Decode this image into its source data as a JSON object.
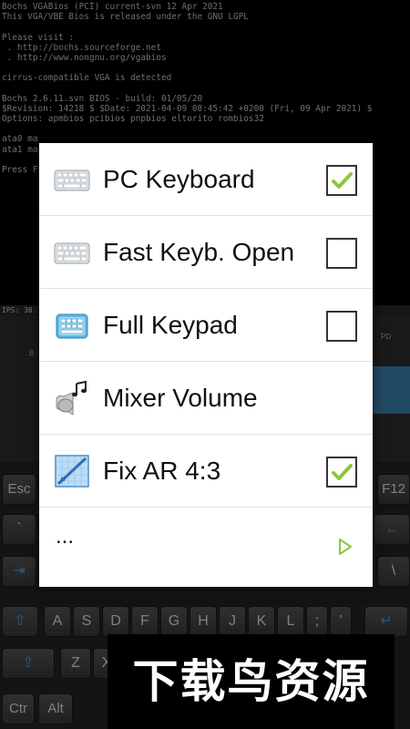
{
  "terminal": {
    "lines": [
      "Bochs VGABios (PCI) current-svn 12 Apr 2021",
      "This VGA/VBE Bios is released under the GNU LGPL",
      "",
      "Please visit :",
      " . http://bochs.sourceforge.net",
      " . http://www.nongnu.org/vgabios",
      "",
      "cirrus-compatible VGA is detected",
      "",
      "Bochs 2.6.11.svn BIOS - build: 01/05/20",
      "$Revision: 14218 $ $Date: 2021-04-09 08:45:42 +0200 (Fri, 09 Apr 2021) $",
      "Options: apmbios pcibios pnpbios eltorito rombios32",
      "",
      "ata0 ma",
      "ata1 ma",
      "",
      "Press F"
    ],
    "status": "IPS: 30."
  },
  "menu": {
    "items": [
      {
        "label": "PC Keyboard",
        "icon": "keyboard-icon",
        "checked": true
      },
      {
        "label": "Fast Keyb. Open",
        "icon": "keyboard-icon",
        "checked": false
      },
      {
        "label": "Full Keypad",
        "icon": "keypad-icon",
        "checked": false
      },
      {
        "label": "Mixer Volume",
        "icon": "speaker-music-icon"
      },
      {
        "label": "Fix AR 4:3",
        "icon": "aspect-ratio-icon",
        "checked": true
      }
    ],
    "more_label": "...",
    "more_icon": "play-arrow-icon"
  },
  "keyboard": {
    "row_fn": [
      "Esc",
      "F12"
    ],
    "row_num": [
      "`",
      "←"
    ],
    "row_tab": [
      "⇥",
      "\\"
    ],
    "row_home": [
      "⇧",
      "A",
      "S",
      "D",
      "F",
      "G",
      "H",
      "J",
      "K",
      "L",
      ";",
      "'",
      "↵"
    ],
    "row_z": [
      "⇧",
      "Z",
      "X"
    ],
    "row_bottom": [
      "Ctr",
      "Alt"
    ],
    "top_labels": [
      "PD",
      "B"
    ]
  },
  "watermark": "下载鸟资源",
  "colors": {
    "check": "#8cc63f",
    "accent_blue": "#4aa3e8",
    "arrow": "#8cc63f"
  }
}
